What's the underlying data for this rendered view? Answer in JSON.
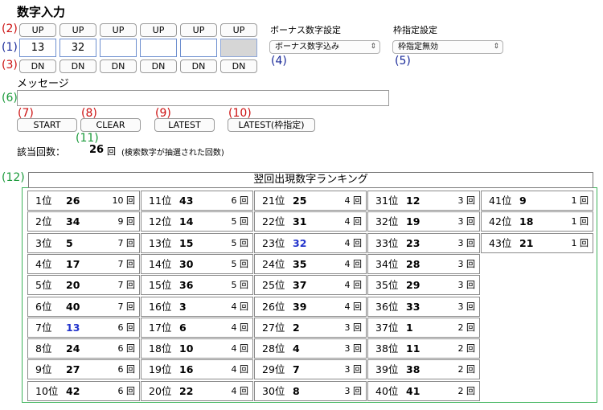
{
  "heading": "数字入力",
  "markers": {
    "m1": "(1)",
    "m2": "(2)",
    "m3": "(3)",
    "m4": "(4)",
    "m5": "(5)",
    "m6": "(6)",
    "m7": "(7)",
    "m8": "(8)",
    "m9": "(9)",
    "m10": "(10)",
    "m11": "(11)",
    "m12": "(12)"
  },
  "up_label": "UP",
  "dn_label": "DN",
  "numbers": [
    "13",
    "32",
    "",
    "",
    "",
    ""
  ],
  "bonus": {
    "label": "ボーナス数字設定",
    "value": "ボーナス数字込み"
  },
  "frame": {
    "label": "枠指定設定",
    "value": "枠指定無効"
  },
  "message": {
    "label": "メッセージ",
    "value": ""
  },
  "buttons": {
    "start": "START",
    "clear": "CLEAR",
    "latest": "LATEST",
    "latest_frame": "LATEST(枠指定)"
  },
  "hits": {
    "label": "該当回数：",
    "value": "26",
    "unit": "回",
    "note": "(検索数字が抽選された回数)"
  },
  "ranking": {
    "title": "翌回出現数字ランキング",
    "unit": "回",
    "columns": [
      [
        {
          "rank": "1位",
          "num": "26",
          "count": "10"
        },
        {
          "rank": "2位",
          "num": "34",
          "count": "9"
        },
        {
          "rank": "3位",
          "num": "5",
          "count": "7"
        },
        {
          "rank": "4位",
          "num": "17",
          "count": "7"
        },
        {
          "rank": "5位",
          "num": "20",
          "count": "7"
        },
        {
          "rank": "6位",
          "num": "40",
          "count": "7"
        },
        {
          "rank": "7位",
          "num": "13",
          "count": "6",
          "hl": true
        },
        {
          "rank": "8位",
          "num": "24",
          "count": "6"
        },
        {
          "rank": "9位",
          "num": "27",
          "count": "6"
        },
        {
          "rank": "10位",
          "num": "42",
          "count": "6"
        }
      ],
      [
        {
          "rank": "11位",
          "num": "43",
          "count": "6"
        },
        {
          "rank": "12位",
          "num": "14",
          "count": "5"
        },
        {
          "rank": "13位",
          "num": "15",
          "count": "5"
        },
        {
          "rank": "14位",
          "num": "30",
          "count": "5"
        },
        {
          "rank": "15位",
          "num": "36",
          "count": "5"
        },
        {
          "rank": "16位",
          "num": "3",
          "count": "4"
        },
        {
          "rank": "17位",
          "num": "6",
          "count": "4"
        },
        {
          "rank": "18位",
          "num": "10",
          "count": "4"
        },
        {
          "rank": "19位",
          "num": "16",
          "count": "4"
        },
        {
          "rank": "20位",
          "num": "22",
          "count": "4"
        }
      ],
      [
        {
          "rank": "21位",
          "num": "25",
          "count": "4"
        },
        {
          "rank": "22位",
          "num": "31",
          "count": "4"
        },
        {
          "rank": "23位",
          "num": "32",
          "count": "4",
          "hl": true
        },
        {
          "rank": "24位",
          "num": "35",
          "count": "4"
        },
        {
          "rank": "25位",
          "num": "37",
          "count": "4"
        },
        {
          "rank": "26位",
          "num": "39",
          "count": "4"
        },
        {
          "rank": "27位",
          "num": "2",
          "count": "3"
        },
        {
          "rank": "28位",
          "num": "4",
          "count": "3"
        },
        {
          "rank": "29位",
          "num": "7",
          "count": "3"
        },
        {
          "rank": "30位",
          "num": "8",
          "count": "3"
        }
      ],
      [
        {
          "rank": "31位",
          "num": "12",
          "count": "3"
        },
        {
          "rank": "32位",
          "num": "19",
          "count": "3"
        },
        {
          "rank": "33位",
          "num": "23",
          "count": "3"
        },
        {
          "rank": "34位",
          "num": "28",
          "count": "3"
        },
        {
          "rank": "35位",
          "num": "29",
          "count": "3"
        },
        {
          "rank": "36位",
          "num": "33",
          "count": "3"
        },
        {
          "rank": "37位",
          "num": "1",
          "count": "2"
        },
        {
          "rank": "38位",
          "num": "11",
          "count": "2"
        },
        {
          "rank": "39位",
          "num": "38",
          "count": "2"
        },
        {
          "rank": "40位",
          "num": "41",
          "count": "2"
        }
      ],
      [
        {
          "rank": "41位",
          "num": "9",
          "count": "1"
        },
        {
          "rank": "42位",
          "num": "18",
          "count": "1"
        },
        {
          "rank": "43位",
          "num": "21",
          "count": "1"
        }
      ]
    ]
  }
}
